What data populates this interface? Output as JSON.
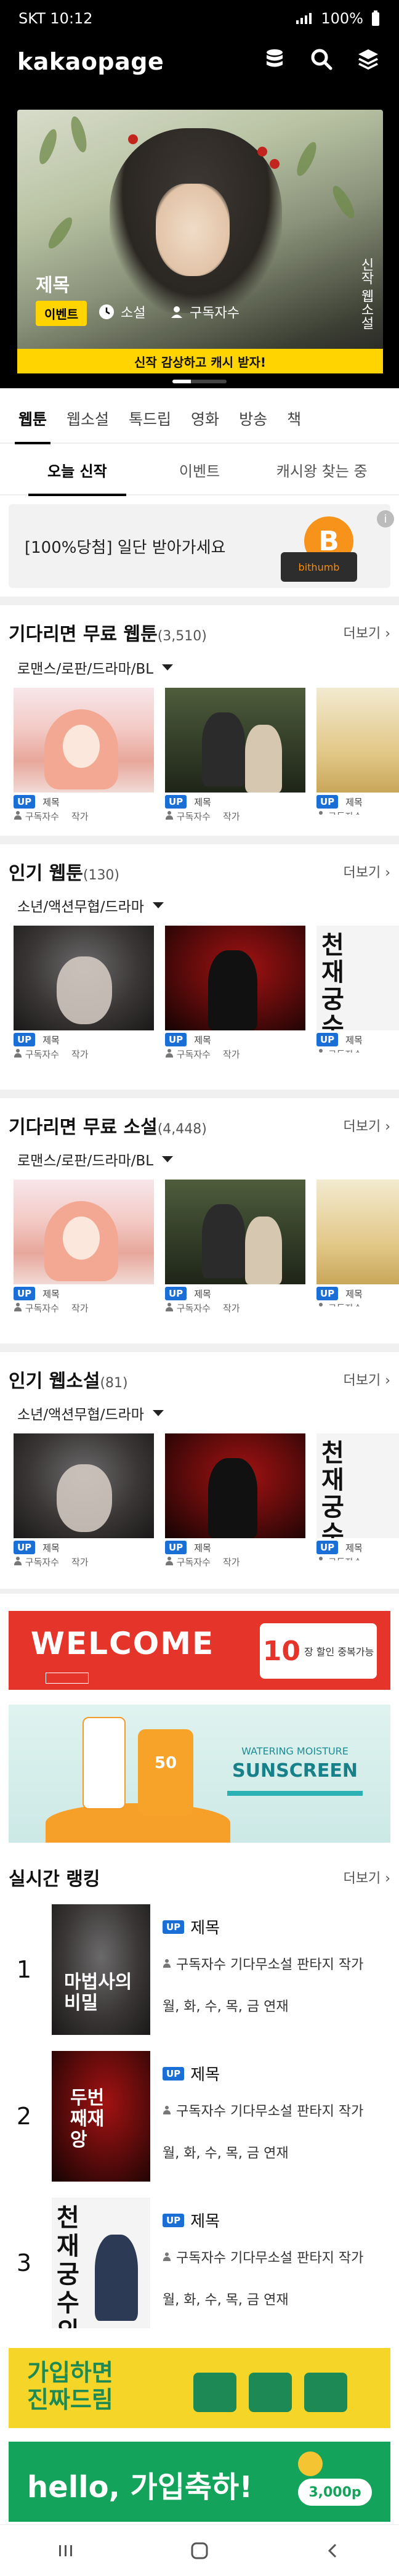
{
  "status": {
    "time": "SKT 10:12",
    "battery": "100%"
  },
  "app": {
    "logo": "kakaopage"
  },
  "hero": {
    "title": "제목",
    "badge": "이벤트",
    "genre": "소설",
    "subscribers": "구독자수",
    "cta": "신작 감상하고 캐시 받자!",
    "vertical_text": "신작 웹소설"
  },
  "tabs": [
    "웹툰",
    "웹소설",
    "톡드립",
    "영화",
    "방송",
    "책"
  ],
  "subtabs": [
    "오늘 신작",
    "이벤트",
    "캐시왕 찾는 중"
  ],
  "ad1": {
    "text": "[100%당첨] 일단 받아가세요",
    "brand": "bithumb",
    "coin": "B",
    "info": "i"
  },
  "sections": [
    {
      "title": "기다리면 무료 웹툰",
      "count": "(3,510)",
      "more": "더보기",
      "filter": "로맨스/로판/드라마/BL"
    },
    {
      "title": "인기 웹툰",
      "count": "(130)",
      "more": "더보기",
      "filter": "소년/액션무협/드라마"
    },
    {
      "title": "기다리면 무료 소설",
      "count": "(4,448)",
      "more": "더보기",
      "filter": "로맨스/로판/드라마/BL"
    },
    {
      "title": "인기 웹소설",
      "count": "(81)",
      "more": "더보기",
      "filter": "소년/액션무협/드라마"
    }
  ],
  "card": {
    "badge": "UP",
    "title": "제목",
    "subscribers": "구독자수",
    "author": "작가"
  },
  "thumb_text": {
    "white": "천재궁수의",
    "vertical_red": "두번째재앙",
    "vertical_rank1": "마법사의 비밀"
  },
  "banners": {
    "red": {
      "headline": "WELCOME",
      "offer_number": "10",
      "offer_text": "장 할인 중복가능"
    },
    "blue": {
      "sub": "WATERING MOISTURE",
      "headline": "SUNSCREEN",
      "spf": "50"
    },
    "yellow": {
      "headline": "가입하면 진짜드림"
    },
    "green": {
      "headline": "hello, 가입축하!",
      "amount": "3,000p"
    }
  },
  "ranking": {
    "title": "실시간 랭킹",
    "more": "더보기",
    "items": [
      {
        "rank": "1",
        "badge": "UP",
        "title": "제목",
        "author": "구독자수 기다무소설 판타지 작가",
        "days": "월, 화, 수, 목, 금 연재"
      },
      {
        "rank": "2",
        "badge": "UP",
        "title": "제목",
        "author": "구독자수 기다무소설 판타지 작가",
        "days": "월, 화, 수, 목, 금 연재"
      },
      {
        "rank": "3",
        "badge": "UP",
        "title": "제목",
        "author": "구독자수 기다무소설 판타지 작가",
        "days": "월, 화, 수, 목, 금 연재"
      }
    ]
  }
}
